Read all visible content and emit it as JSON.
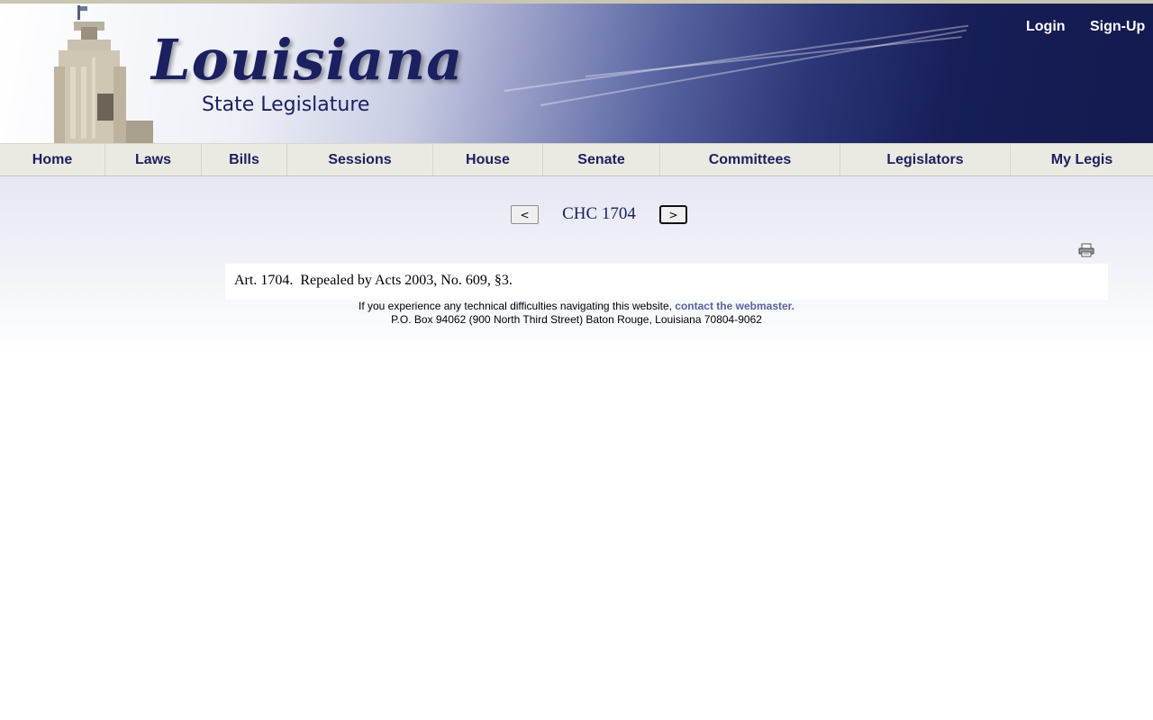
{
  "header": {
    "logo_script": "Louisiana",
    "logo_subtitle": "State Legislature",
    "login": "Login",
    "signup": "Sign-Up"
  },
  "nav": [
    {
      "label": "Home"
    },
    {
      "label": "Laws"
    },
    {
      "label": "Bills"
    },
    {
      "label": "Sessions"
    },
    {
      "label": "House"
    },
    {
      "label": "Senate"
    },
    {
      "label": "Committees"
    },
    {
      "label": "Legislators"
    },
    {
      "label": "My Legis"
    }
  ],
  "pager": {
    "prev": "<",
    "title": "CHC 1704",
    "next": ">"
  },
  "toolbar": {
    "print_icon": "print-icon"
  },
  "law": {
    "text": "Art. 1704.  Repealed by Acts 2003, No. 609, §3."
  },
  "footer": {
    "difficulty_text": "If you experience any technical difficulties navigating this website, ",
    "webmaster_link": "contact the webmaster.",
    "address": "P.O. Box 94062 (900 North Third Street) Baton Rouge, Louisiana 70804-9062"
  },
  "colors": {
    "brand_navy": "#1b2060",
    "nav_bg": "#ebeae2",
    "link": "#5b629b"
  }
}
